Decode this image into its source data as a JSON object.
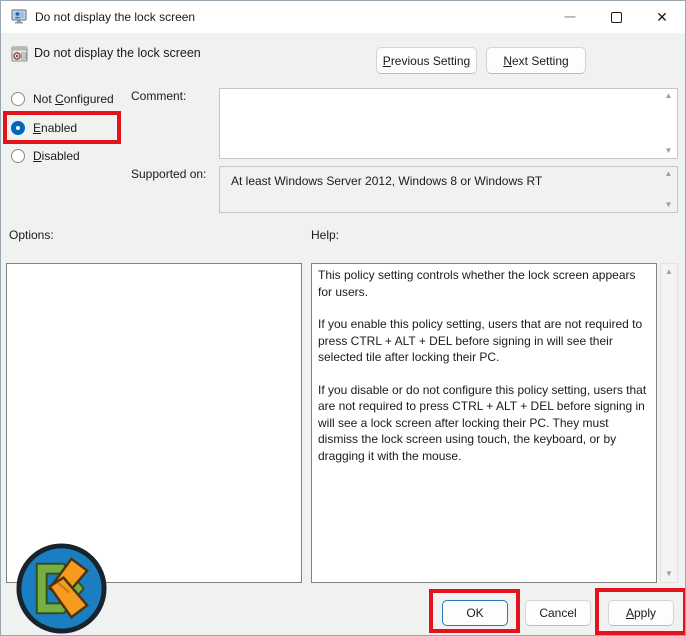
{
  "window": {
    "title": "Do not display the lock screen",
    "controls": {
      "minimize": "—",
      "close": "✕"
    }
  },
  "header": {
    "setting_name": "Do not display the lock screen",
    "previous_button": {
      "pre": "",
      "key": "P",
      "post": "revious Setting"
    },
    "next_button": {
      "pre": "",
      "key": "N",
      "post": "ext Setting"
    }
  },
  "radios": [
    {
      "pre": "Not ",
      "key": "C",
      "post": "onfigured",
      "selected": false
    },
    {
      "pre": "",
      "key": "E",
      "post": "nabled",
      "selected": true
    },
    {
      "pre": "",
      "key": "D",
      "post": "isabled",
      "selected": false
    }
  ],
  "comment": {
    "label": "Comment:",
    "value": ""
  },
  "supported_on": {
    "label": "Supported on:",
    "value": "At least Windows Server 2012, Windows 8 or Windows RT"
  },
  "options_panel": {
    "label": "Options:"
  },
  "help_panel": {
    "label": "Help:",
    "paragraphs": [
      "This policy setting controls whether the lock screen appears for users.",
      "If you enable this policy setting, users that are not required to press CTRL + ALT + DEL before signing in will see their selected tile after locking their PC.",
      "If you disable or do not configure this policy setting, users that are not required to press CTRL + ALT + DEL before signing in will see a lock screen after locking their PC. They must dismiss the lock screen using touch, the keyboard, or by dragging it with the mouse."
    ]
  },
  "footer": {
    "ok": "OK",
    "cancel": "Cancel",
    "apply": {
      "pre": "",
      "key": "A",
      "post": "pply"
    }
  },
  "scroll": {
    "up": "▲",
    "down": "▼"
  },
  "annotation_color": "#e3131b",
  "colors": {
    "accent_blue": "#0067c0",
    "titlebar": "#ffffff",
    "body": "#f0f1f1",
    "logo_blue": "#1b7ec2",
    "logo_green": "#76b043",
    "logo_orange": "#f59b20"
  }
}
